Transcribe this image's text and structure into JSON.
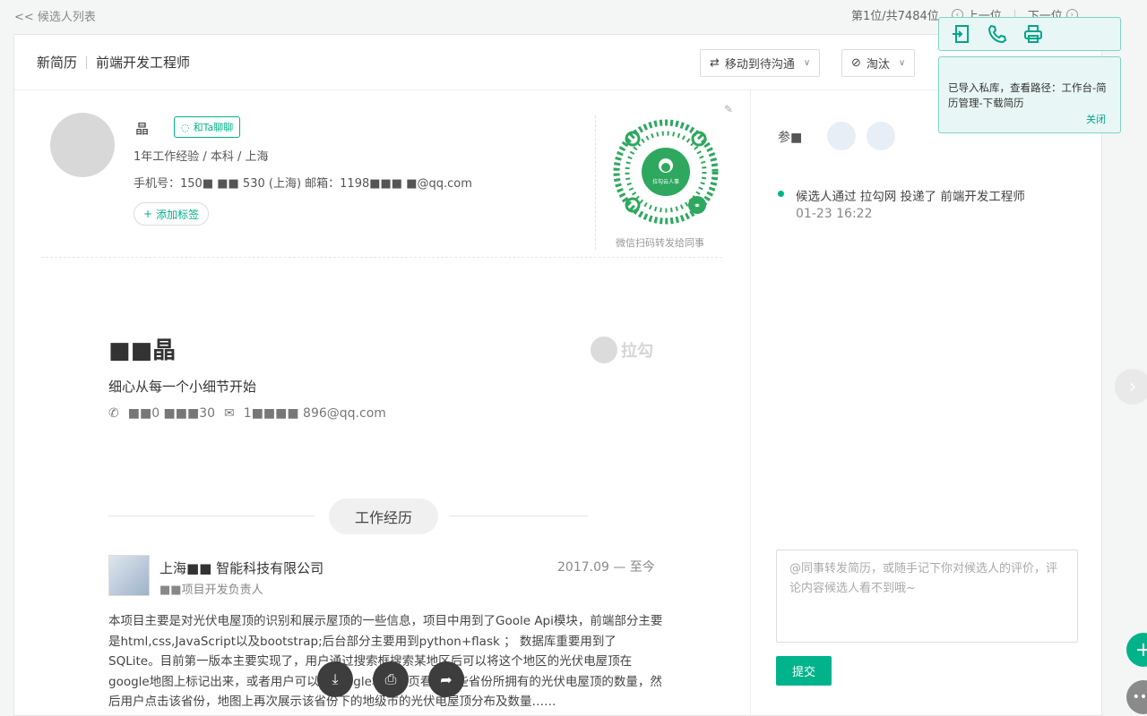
{
  "topbar": {
    "back_label": "<< 候选人列表",
    "position": "第1位/共7484位",
    "prev_label": "上一位",
    "next_label": "下一位"
  },
  "header": {
    "status": "新简历",
    "job_title": "前端开发工程师",
    "move_button": "移动到待沟通",
    "reject_button": "淘汰"
  },
  "candidate": {
    "name": "晶",
    "chat_button": "和Ta聊聊",
    "meta": "1年工作经验 / 本科 / 上海",
    "contact": "手机号：150■ ■■ 530 (上海)  邮箱：1198■■■  ■@qq.com",
    "add_tag": "添加标签",
    "qr_center": "拉勾云人事",
    "qr_caption": "微信扫码转发给同事"
  },
  "resume": {
    "name": "■■晶",
    "motto": "细心从每一个小细节开始",
    "phone": "■■0 ■■■30",
    "email": "1■■■■ 896@qq.com",
    "logo_text": "拉勾",
    "section_title": "工作经历",
    "company": "上海■■ 智能科技有限公司",
    "role": "■■项目开发负责人",
    "date": "2017.09 — 至今",
    "description": "本项目主要是对光伏电屋顶的识别和展示屋顶的一些信息，项目中用到了Goole Api模块，前端部分主要是html,css,JavaScript以及bootstrap;后台部分主要用到python+flask ； 数据库重要用到了SQLite。目前第一版本主要实现了，用户通过搜索框搜索某地区后可以将这个地区的光伏电屋顶在google地图上标记出来，或者用户可以在google地图首页看到某些省份所拥有的光伏电屋顶的数量，然后用户点击该省份，地图上再次展示该省份下的地级市的光伏电屋顶分布及数量……"
  },
  "right": {
    "label": "参■",
    "timeline_text": "候选人通过 拉勾网 投递了 前端开发工程师",
    "timeline_time": "01-23  16:22",
    "comment_placeholder": "@同事转发简历，或随手记下你对候选人的评价，评论内容候选人看不到哦~",
    "submit": "提交"
  },
  "notice": {
    "text": "已导入私库，查看路径：工作台-简历管理-下载简历",
    "close": "关闭"
  },
  "colors": {
    "accent": "#00b38a"
  }
}
